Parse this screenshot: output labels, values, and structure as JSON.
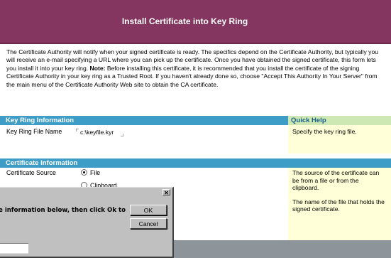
{
  "header": {
    "title": "Install Certificate into Key Ring"
  },
  "intro": {
    "text_part1": "The Certificate Authority will notify when your signed certificate is ready. The specifics depend on the Certificate Authority, but typically you will receive an e-mail specifying a URL where you can pick up the certificate. Once you have obtained the signed certificate, this form lets you install it into your key ring.",
    "note_label": "Note:",
    "text_part2": "Before installing this certificate, it is recommended that you install the certificate of the signing Certificate Authority in your key ring as a Trusted Root.  If you haven't already done so, choose \"Accept This Authority In Your Server\" from the main menu of the Certificate Authority Web site to obtain the CA certificate."
  },
  "key_ring_section": {
    "heading": "Key Ring Information",
    "field_label": "Key Ring File Name",
    "field_value": "c:\\keyfile.kyr"
  },
  "quick_help": {
    "heading": "Quick Help",
    "key_ring_help": "Specify the key ring file.",
    "source_help": "The source of the certificate can be from a file or from the clipboard.",
    "file_help": "The name of the file that holds the signed certificate."
  },
  "certificate_section": {
    "heading": "Certificate Information",
    "source_label": "Certificate Source",
    "option_file": "File",
    "option_clipboard": "Clipboard"
  },
  "dialog": {
    "message": "e information below, then click Ok to",
    "ok_label": "OK",
    "cancel_label": "Cancel",
    "close_glyph": "✕"
  },
  "colors": {
    "header_bg": "#853660",
    "section_band": "#3d9dc6",
    "quick_help_head": "#cde8b3",
    "quick_help_body": "#ffffd8",
    "dialog_bg": "#c0c0c0"
  }
}
